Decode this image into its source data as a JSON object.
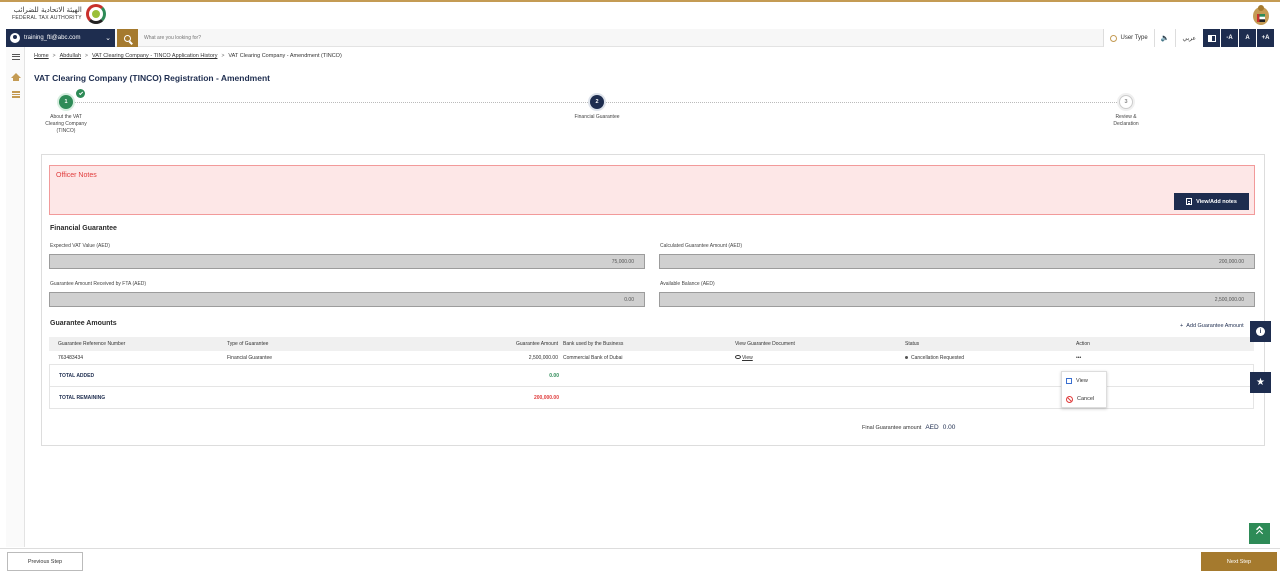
{
  "header": {
    "logo_ar": "الهيئة الاتحادية للضرائب",
    "logo_en": "FEDERAL TAX AUTHORITY"
  },
  "navbar": {
    "user_email": "training_fti@abc.com",
    "search_placeholder": "What are you looking for?",
    "user_type_label": "User Type",
    "lang_label": "عربي",
    "font_decrease": "-A",
    "font_normal": "A",
    "font_increase": "+A"
  },
  "breadcrumb": {
    "items": [
      "Home",
      "Abdullah",
      "VAT Clearing Company - TINCO Application History",
      "VAT Clearing Company - Amendment (TINCO)"
    ]
  },
  "page": {
    "title": "VAT Clearing Company (TINCO) Registration - Amendment"
  },
  "stepper": {
    "steps": [
      {
        "number": "1",
        "label_lines": [
          "About the VAT",
          "Clearing Company",
          "(TINCO)"
        ],
        "state": "complete"
      },
      {
        "number": "2",
        "label_lines": [
          "Financial Guarantee"
        ],
        "state": "active"
      },
      {
        "number": "3",
        "label_lines": [
          "Review &",
          "Declaration"
        ],
        "state": "pending"
      }
    ]
  },
  "notes": {
    "title": "Officer Notes",
    "button_label": "View/Add notes"
  },
  "financial_guarantee": {
    "title": "Financial Guarantee",
    "fields": [
      {
        "label": "Expected VAT Value (AED)",
        "value": "75,000.00"
      },
      {
        "label": "Calculated Guarantee Amount (AED)",
        "value": "200,000.00"
      },
      {
        "label": "Guarantee Amount Received by FTA (AED)",
        "value": "0.00"
      },
      {
        "label": "Available Balance (AED)",
        "value": "2,500,000.00"
      }
    ]
  },
  "guarantee_amounts": {
    "title": "Guarantee Amounts",
    "add_link": "Add Guarantee Amount",
    "columns": [
      "Guarantee Reference Number",
      "Type of Guarantee",
      "Guarantee Amount",
      "Bank used by the Business",
      "View Guarantee Document",
      "Status",
      "Action"
    ],
    "rows": [
      {
        "ref": "763483434",
        "type": "Financial Guarantee",
        "amount": "2,500,000.00",
        "bank": "Commercial Bank of Dubai",
        "document": "View",
        "status": "Cancellation Requested",
        "action": "•••"
      }
    ],
    "total_added_label": "TOTAL ADDED",
    "total_added_value": "0.00",
    "total_remaining_label": "TOTAL REMAINING",
    "total_remaining_value": "200,000.00",
    "action_menu": [
      "View",
      "Cancel"
    ],
    "final_label": "Final Guarantee amount",
    "final_currency": "AED",
    "final_value": "0.00"
  },
  "footer": {
    "prev_label": "Previous Step",
    "next_label": "Next Step"
  },
  "colors": {
    "navy": "#1e2d4f",
    "gold": "#a57a2e",
    "green": "#2e8b57",
    "red": "#e03b3b"
  }
}
